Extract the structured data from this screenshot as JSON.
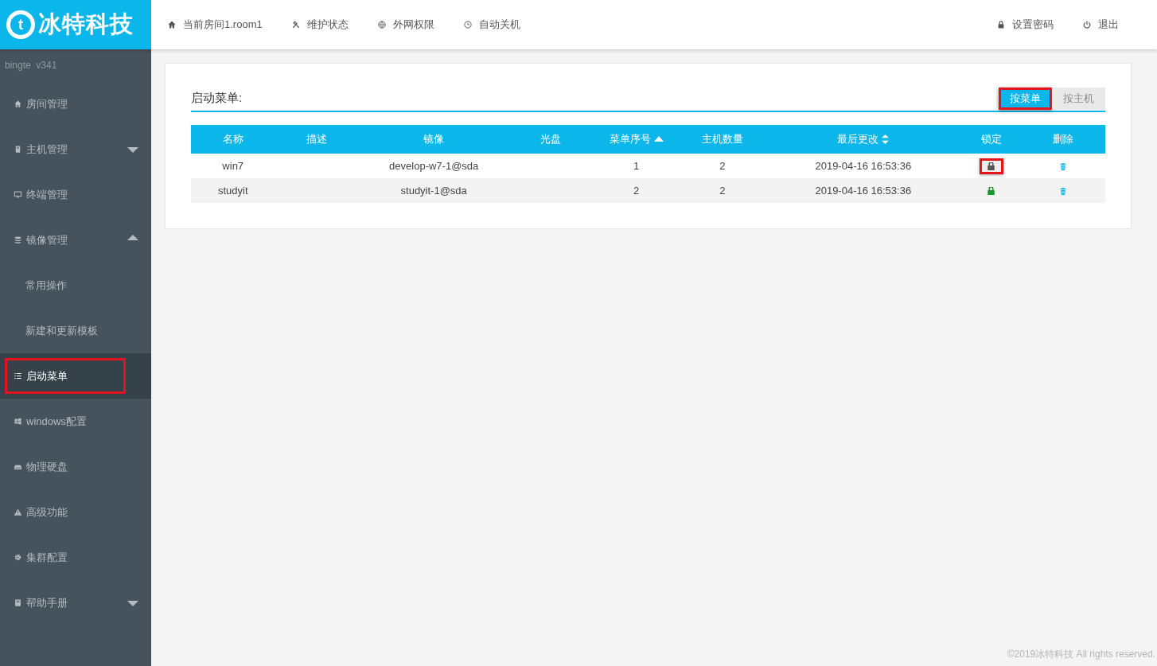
{
  "logo": {
    "mark": "t",
    "text": "冰特科技"
  },
  "top_nav": [
    {
      "label": "当前房间1.room1"
    },
    {
      "label": "维护状态"
    },
    {
      "label": "外网权限"
    },
    {
      "label": "自动关机"
    }
  ],
  "top_right": [
    {
      "label": "设置密码"
    },
    {
      "label": "退出"
    }
  ],
  "sidebar": {
    "version": "bingte  v341",
    "items": [
      {
        "label": "房间管理",
        "selected": false,
        "highlighted": false
      },
      {
        "label": "主机管理",
        "selected": false,
        "highlighted": false,
        "expanded": false
      },
      {
        "label": "终端管理",
        "selected": false,
        "highlighted": false
      },
      {
        "label": "镜像管理",
        "selected": false,
        "highlighted": false,
        "expanded": true,
        "children": [
          {
            "label": "常用操作",
            "selected": false,
            "highlighted": false
          },
          {
            "label": "新建和更新模板",
            "selected": false,
            "highlighted": false
          }
        ]
      },
      {
        "label": "启动菜单",
        "selected": true,
        "highlighted": true
      },
      {
        "label": "windows配置",
        "selected": false,
        "highlighted": false
      },
      {
        "label": "物理硬盘",
        "selected": false,
        "highlighted": false
      },
      {
        "label": "高级功能",
        "selected": false,
        "highlighted": false
      },
      {
        "label": "集群配置",
        "selected": false,
        "highlighted": false
      },
      {
        "label": "帮助手册",
        "selected": false,
        "highlighted": false,
        "expanded": false
      }
    ]
  },
  "panel": {
    "title": "启动菜单:",
    "tabs": [
      {
        "label": "按菜单",
        "selected": true,
        "highlighted": true
      },
      {
        "label": "按主机",
        "selected": false,
        "highlighted": false
      }
    ],
    "table": {
      "columns": [
        {
          "label": "名称",
          "kind": "plain"
        },
        {
          "label": "描述",
          "kind": "plain"
        },
        {
          "label": "镜像",
          "kind": "plain"
        },
        {
          "label": "光盘",
          "kind": "plain"
        },
        {
          "label": "菜单序号",
          "kind": "sorted"
        },
        {
          "label": "主机数量",
          "kind": "plain"
        },
        {
          "label": "最后更改",
          "kind": "sortable"
        },
        {
          "label": "锁定",
          "kind": "plain"
        },
        {
          "label": "删除",
          "kind": "plain"
        }
      ],
      "rows": [
        {
          "name": "win7",
          "image": "develop-w7-1@sda",
          "order": "1",
          "hosts": "2",
          "modified": "2019-04-16 16:53:36",
          "lock": {
            "color": "#555555",
            "highlighted": true
          }
        },
        {
          "name": "studyit",
          "image": "studyit-1@sda",
          "order": "2",
          "hosts": "2",
          "modified": "2019-04-16 16:53:36",
          "lock": {
            "color": "#1a9a2a",
            "highlighted": false
          }
        }
      ]
    }
  },
  "footer": "©2019冰特科技 All rights reserved."
}
